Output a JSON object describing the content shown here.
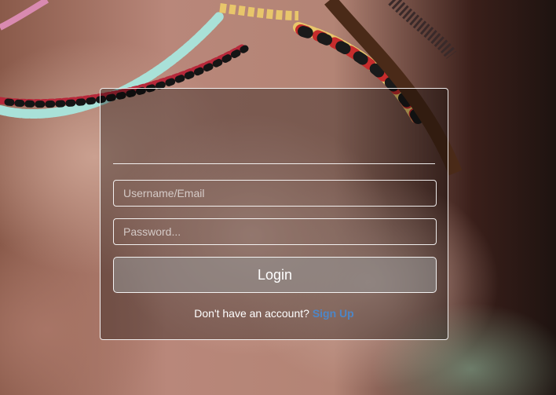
{
  "login_form": {
    "username_placeholder": "Username/Email",
    "password_placeholder": "Password...",
    "login_label": "Login",
    "signup_prompt": "Don't have an account?",
    "signup_link": "Sign Up"
  },
  "colors": {
    "link": "#4d86c7",
    "card_border": "#ffffff"
  }
}
